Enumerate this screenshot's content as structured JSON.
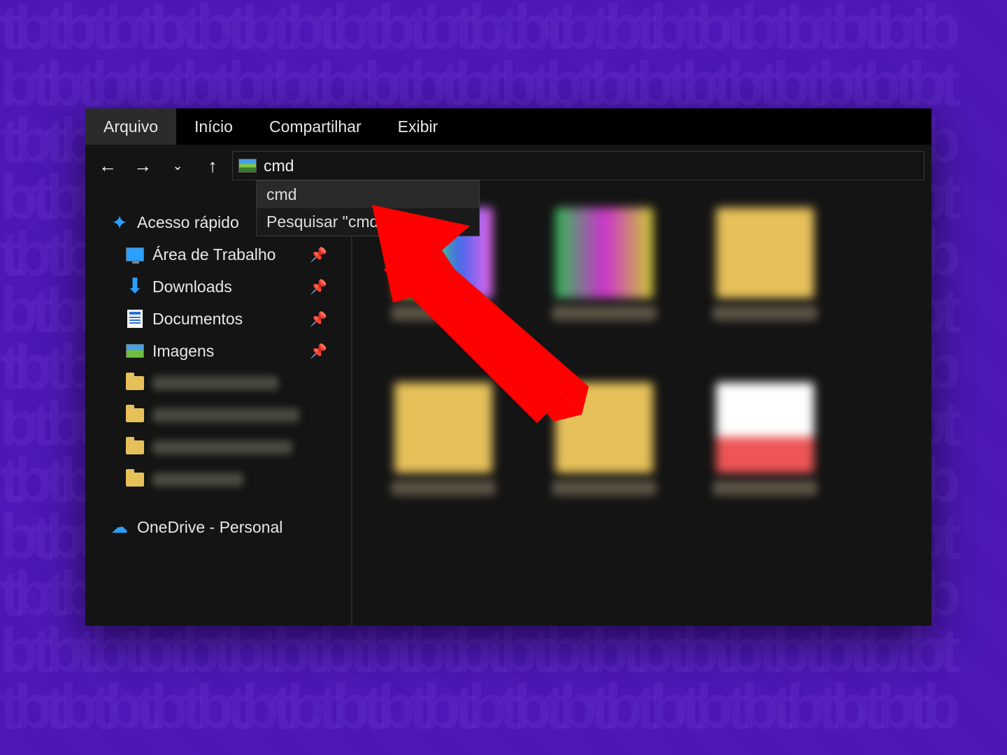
{
  "ribbon": {
    "tabs": [
      "Arquivo",
      "Início",
      "Compartilhar",
      "Exibir"
    ],
    "active_index": 0
  },
  "address": {
    "value": "cmd",
    "suggestions": [
      "cmd",
      "Pesquisar \"cmd\""
    ]
  },
  "sidebar": {
    "quick_access_label": "Acesso rápido",
    "items": [
      {
        "label": "Área de Trabalho",
        "pinned": true
      },
      {
        "label": "Downloads",
        "pinned": true
      },
      {
        "label": "Documentos",
        "pinned": true
      },
      {
        "label": "Imagens",
        "pinned": true
      }
    ],
    "onedrive_label": "OneDrive - Personal"
  }
}
